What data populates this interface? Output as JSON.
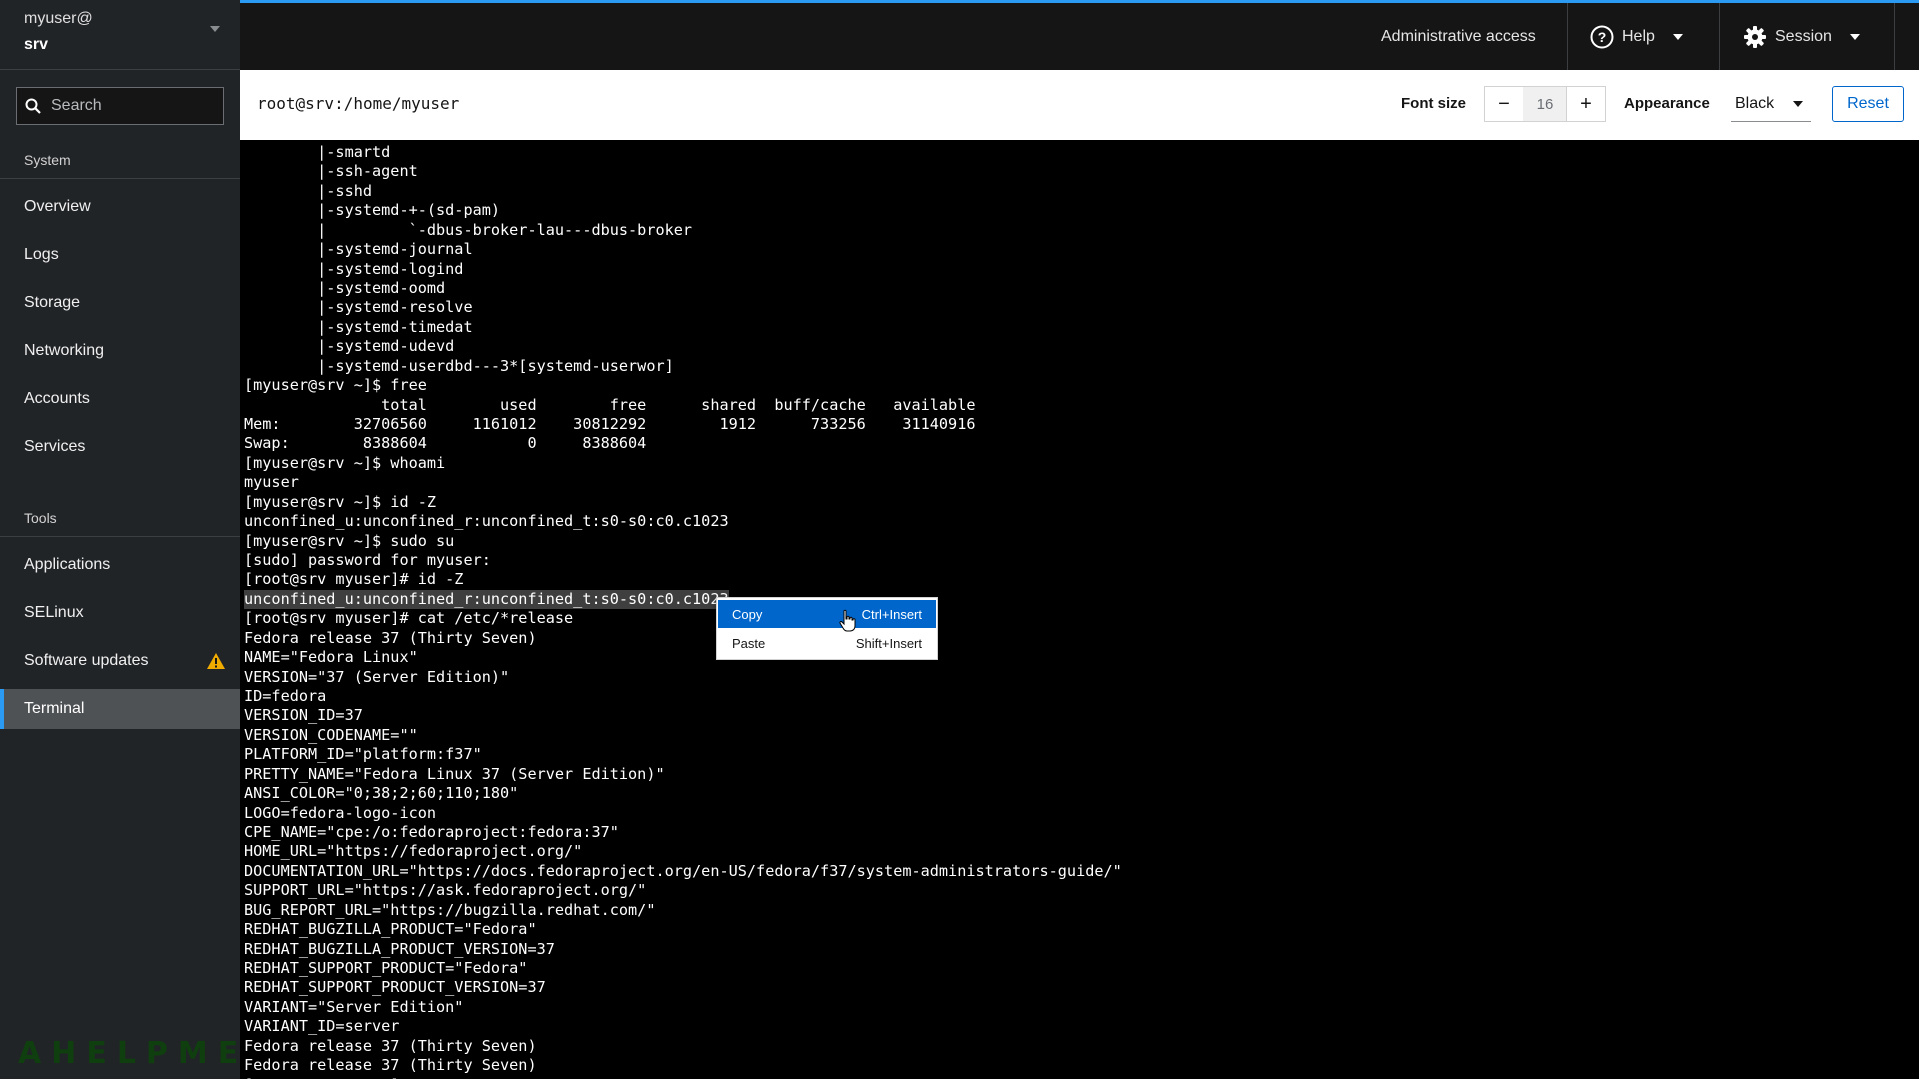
{
  "host": {
    "user": "myuser@",
    "name": "srv"
  },
  "search": {
    "placeholder": "Search"
  },
  "nav": {
    "system_title": "System",
    "system_items": [
      "Overview",
      "Logs",
      "Storage",
      "Networking",
      "Accounts",
      "Services"
    ],
    "tools_title": "Tools",
    "tools_items": [
      "Applications",
      "SELinux",
      "Software updates",
      "Terminal"
    ],
    "active": "Terminal"
  },
  "watermark": "AHELPME",
  "topbar": {
    "admin_access": "Administrative access",
    "help": "Help",
    "session": "Session",
    "accent_color": "#2b9af3"
  },
  "terminal_header": {
    "title": "root@srv:/home/myuser",
    "font_size_label": "Font size",
    "font_size_minus": "−",
    "font_size_value": "16",
    "font_size_plus": "+",
    "appearance_label": "Appearance",
    "appearance_value": "Black",
    "reset_label": "Reset"
  },
  "terminal": {
    "lines": [
      "        |-smartd",
      "        |-ssh-agent",
      "        |-sshd",
      "        |-systemd-+-(sd-pam)",
      "        |         `-dbus-broker-lau---dbus-broker",
      "        |-systemd-journal",
      "        |-systemd-logind",
      "        |-systemd-oomd",
      "        |-systemd-resolve",
      "        |-systemd-timedat",
      "        |-systemd-udevd",
      "        |-systemd-userdbd---3*[systemd-userwor]",
      "[myuser@srv ~]$ free",
      "               total        used        free      shared  buff/cache   available",
      "Mem:        32706560     1161012    30812292        1912      733256    31140916",
      "Swap:        8388604           0     8388604",
      "[myuser@srv ~]$ whoami",
      "myuser",
      "[myuser@srv ~]$ id -Z",
      "unconfined_u:unconfined_r:unconfined_t:s0-s0:c0.c1023",
      "[myuser@srv ~]$ sudo su",
      "[sudo] password for myuser:",
      "[root@srv myuser]# id -Z",
      "unconfined_u:unconfined_r:unconfined_t:s0-s0:c0.c1023",
      "[root@srv myuser]# cat /etc/*release",
      "Fedora release 37 (Thirty Seven)",
      "NAME=\"Fedora Linux\"",
      "VERSION=\"37 (Server Edition)\"",
      "ID=fedora",
      "VERSION_ID=37",
      "VERSION_CODENAME=\"\"",
      "PLATFORM_ID=\"platform:f37\"",
      "PRETTY_NAME=\"Fedora Linux 37 (Server Edition)\"",
      "ANSI_COLOR=\"0;38;2;60;110;180\"",
      "LOGO=fedora-logo-icon",
      "CPE_NAME=\"cpe:/o:fedoraproject:fedora:37\"",
      "HOME_URL=\"https://fedoraproject.org/\"",
      "DOCUMENTATION_URL=\"https://docs.fedoraproject.org/en-US/fedora/f37/system-administrators-guide/\"",
      "SUPPORT_URL=\"https://ask.fedoraproject.org/\"",
      "BUG_REPORT_URL=\"https://bugzilla.redhat.com/\"",
      "REDHAT_BUGZILLA_PRODUCT=\"Fedora\"",
      "REDHAT_BUGZILLA_PRODUCT_VERSION=37",
      "REDHAT_SUPPORT_PRODUCT=\"Fedora\"",
      "REDHAT_SUPPORT_PRODUCT_VERSION=37",
      "VARIANT=\"Server Edition\"",
      "VARIANT_ID=server",
      "Fedora release 37 (Thirty Seven)",
      "Fedora release 37 (Thirty Seven)",
      "[root@srv myuser]# "
    ],
    "selected_line": 23
  },
  "context_menu": {
    "items": [
      {
        "label": "Copy",
        "shortcut": "Ctrl+Insert",
        "highlighted": true
      },
      {
        "label": "Paste",
        "shortcut": "Shift+Insert",
        "highlighted": false
      }
    ]
  }
}
